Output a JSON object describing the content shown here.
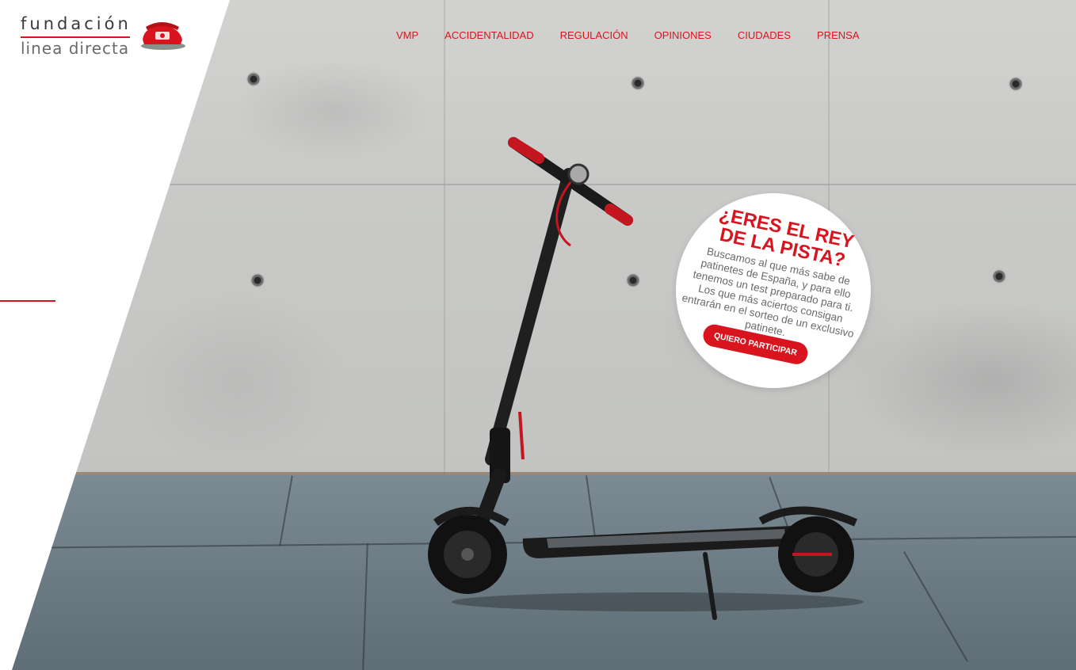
{
  "brand": {
    "line1": "fundación",
    "line2": "linea directa",
    "colors": {
      "accent": "#d9141e",
      "text": "#3a3a3a"
    }
  },
  "nav": {
    "items": [
      {
        "label": "VMP"
      },
      {
        "label": "ACCIDENTALIDAD"
      },
      {
        "label": "REGULACIÓN"
      },
      {
        "label": "OPINIONES"
      },
      {
        "label": "CIUDADES"
      },
      {
        "label": "PRENSA"
      }
    ]
  },
  "promo": {
    "title_line1": "¿ERES EL REY",
    "title_line2": "DE LA PISTA?",
    "body": "Buscamos al que más sabe de patinetes de España, y para ello tenemos un test preparado para ti. Los que más aciertos consigan entrarán en el sorteo de un exclusivo patinete.",
    "button_label": "QUIERO PARTICIPAR"
  },
  "icons": {
    "logo_mark": "red-phone-icon",
    "hero": "electric-scooter-photo"
  }
}
